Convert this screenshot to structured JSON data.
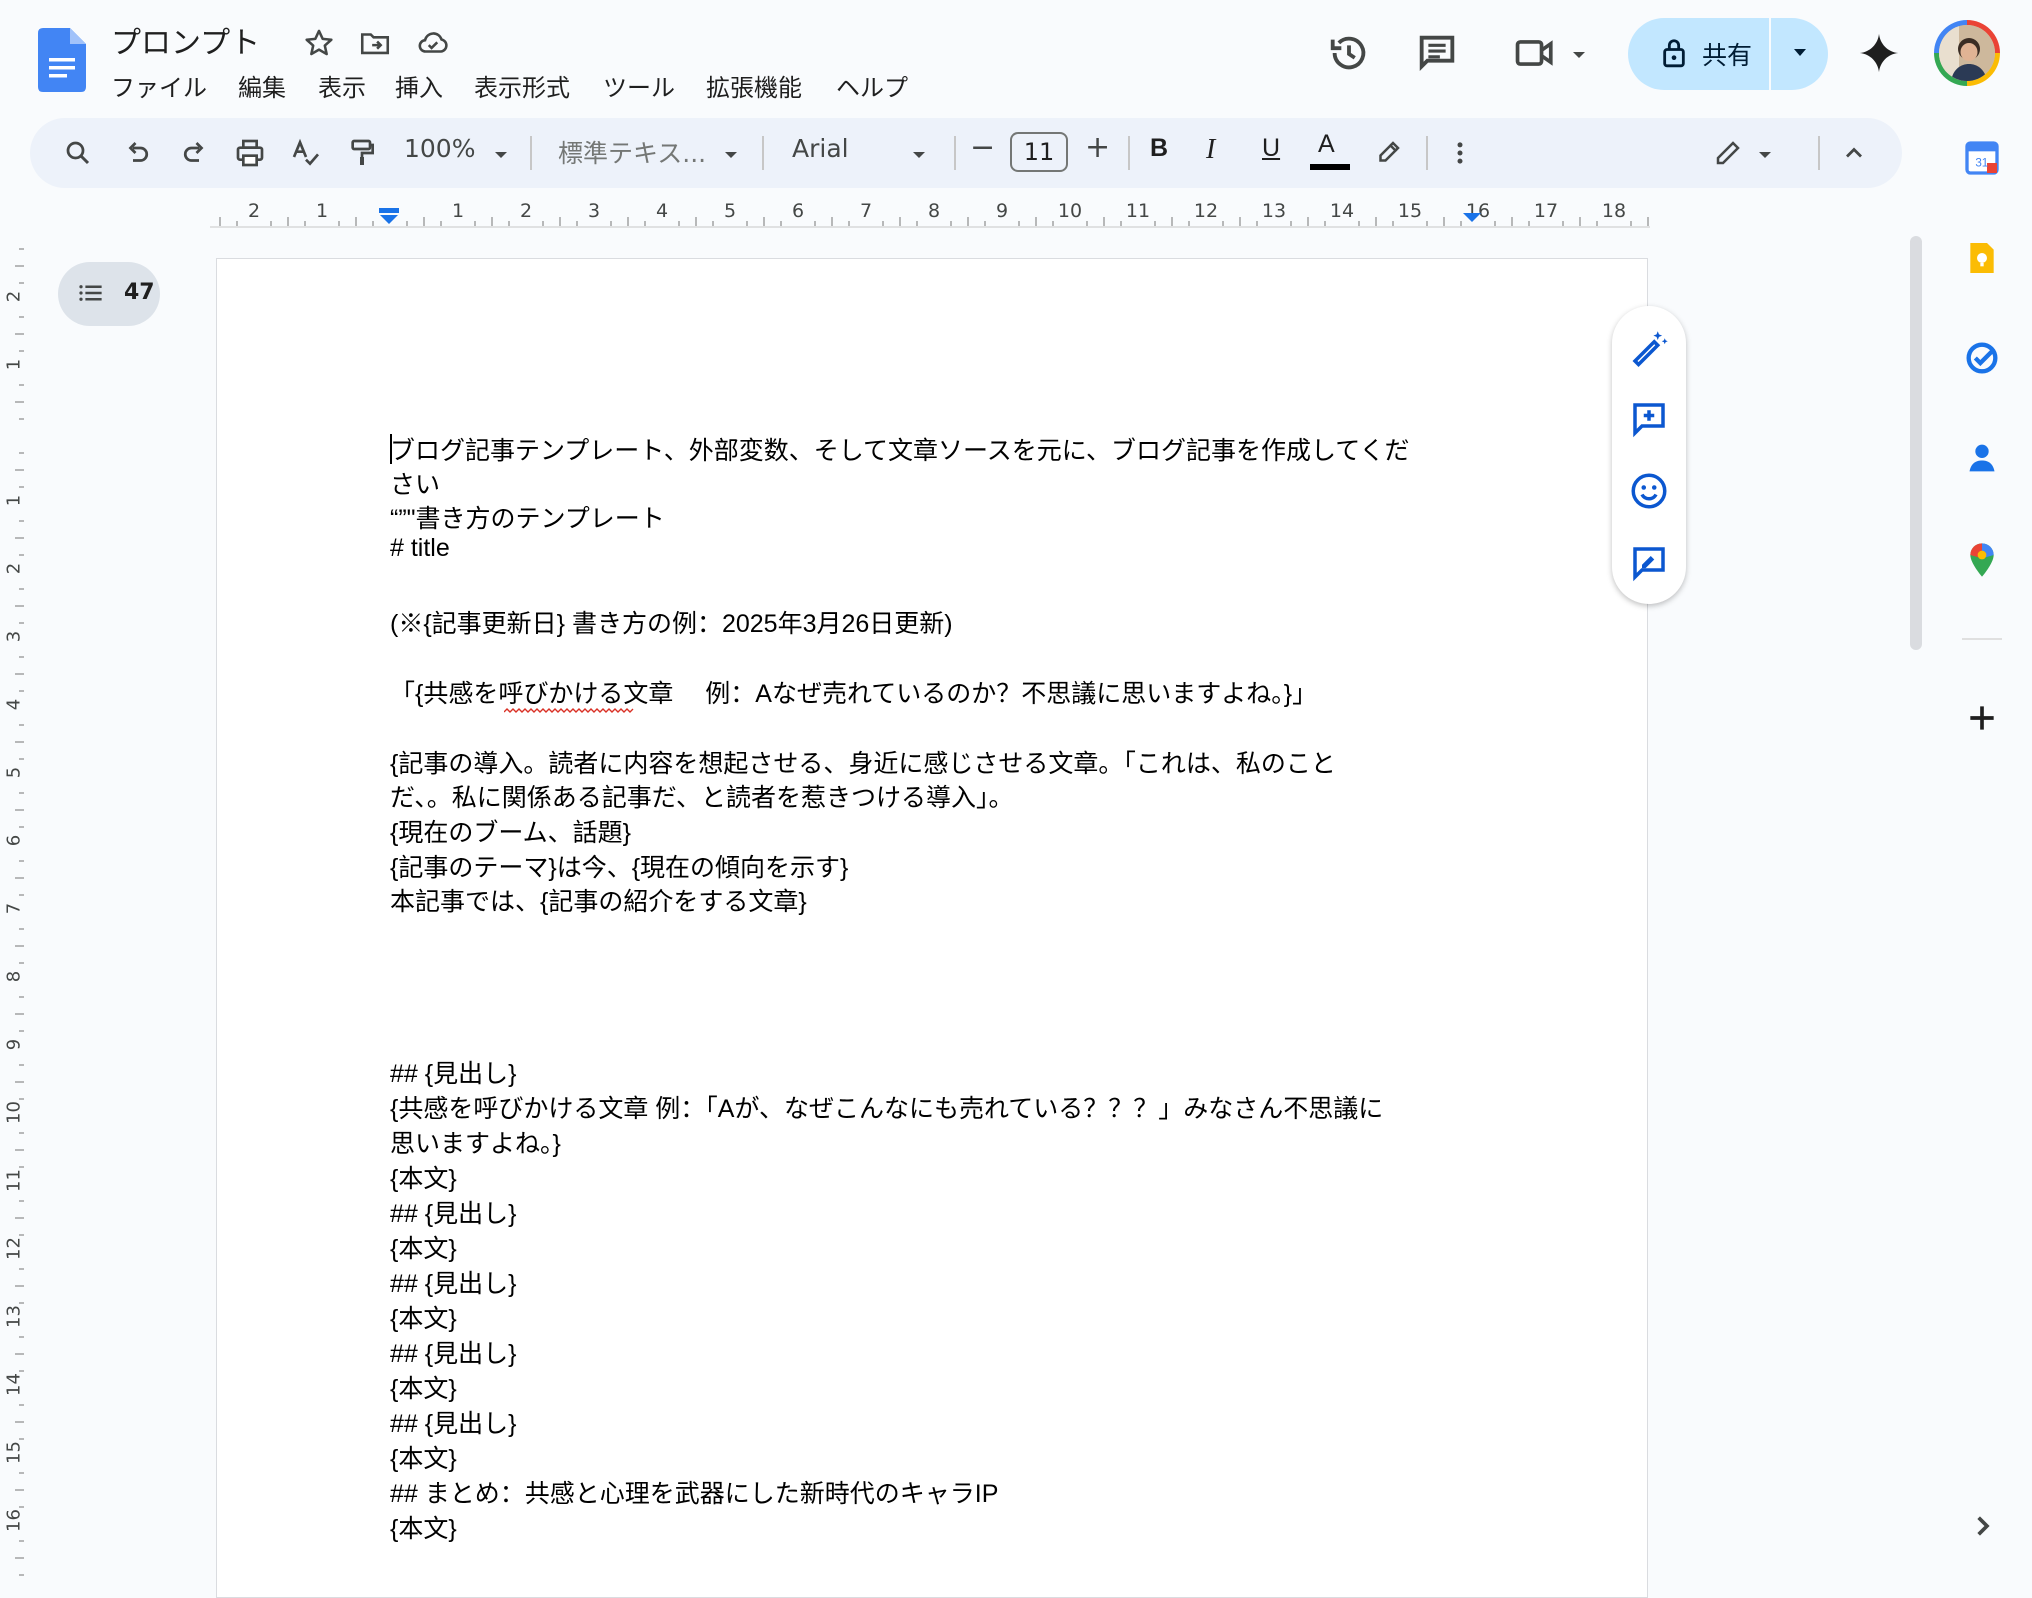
{
  "header": {
    "title": "プロンプト",
    "menu": [
      "ファイル",
      "編集",
      "表示",
      "挿入",
      "表示形式",
      "ツール",
      "拡張機能",
      "ヘルプ"
    ],
    "share_label": "共有",
    "icons": [
      "star-icon",
      "move-folder-icon",
      "cloud-status-icon",
      "history-icon",
      "comments-icon",
      "meet-icon",
      "gemini-icon"
    ]
  },
  "toolbar": {
    "zoom": "100%",
    "style": "標準テキス...",
    "font": "Arial",
    "font_size": "11",
    "minus": "−",
    "plus": "+",
    "bold": "B",
    "italic": "I",
    "underline": "U",
    "text_color": "A"
  },
  "ruler": {
    "numbers": [
      "2",
      "1",
      "1",
      "2",
      "3",
      "4",
      "5",
      "6",
      "7",
      "8",
      "9",
      "10",
      "11",
      "12",
      "13",
      "14",
      "15",
      "16",
      "17",
      "18"
    ],
    "vertical_numbers": [
      "2",
      "1",
      "1",
      "2",
      "3",
      "4",
      "5",
      "6",
      "7",
      "8",
      "9",
      "10",
      "11",
      "12",
      "13",
      "14",
      "15",
      "16"
    ]
  },
  "outline": {
    "count": "47"
  },
  "document": {
    "lines": [
      "ブログ記事テンプレート、外部変数、そして文章ソースを元に、ブログ記事を作成してくだ",
      "さい",
      "“”\"書き方のテンプレート",
      "# title",
      "",
      "(※{記事更新日} 書き方の例：2025年3月26日更新)",
      "",
      "「{共感を呼びかける文章　 例：Aなぜ売れているのか？不思議に思いますよね。}」",
      "",
      "{記事の導入。読者に内容を想起させる、身近に感じさせる文章。「これは、私のこと",
      "だ、。私に関係ある記事だ、と読者を惹きつける導入」。",
      "{現在のブーム、話題}",
      "{記事のテーマ}は今、{現在の傾向を示す}",
      "本記事では、{記事の紹介をする文章}",
      "",
      "",
      "",
      "",
      "## {見出し}",
      "{共感を呼びかける文章 例：「Aが、なぜこんなにも売れている？？？」みなさん不思議に",
      "思いますよね。}",
      "{本文}",
      "## {見出し}",
      "{本文}",
      "## {見出し}",
      "{本文}",
      "## {見出し}",
      "{本文}",
      "## {見出し}",
      "{本文}",
      "## まとめ：共感と心理を武器にした新時代のキャラIP",
      "{本文}"
    ]
  },
  "colors": {
    "brand_blue": "#1a73e8",
    "share_bg": "#c2e7ff",
    "toolbar_bg": "#edf2fa",
    "spellcheck_red": "#d93025"
  }
}
